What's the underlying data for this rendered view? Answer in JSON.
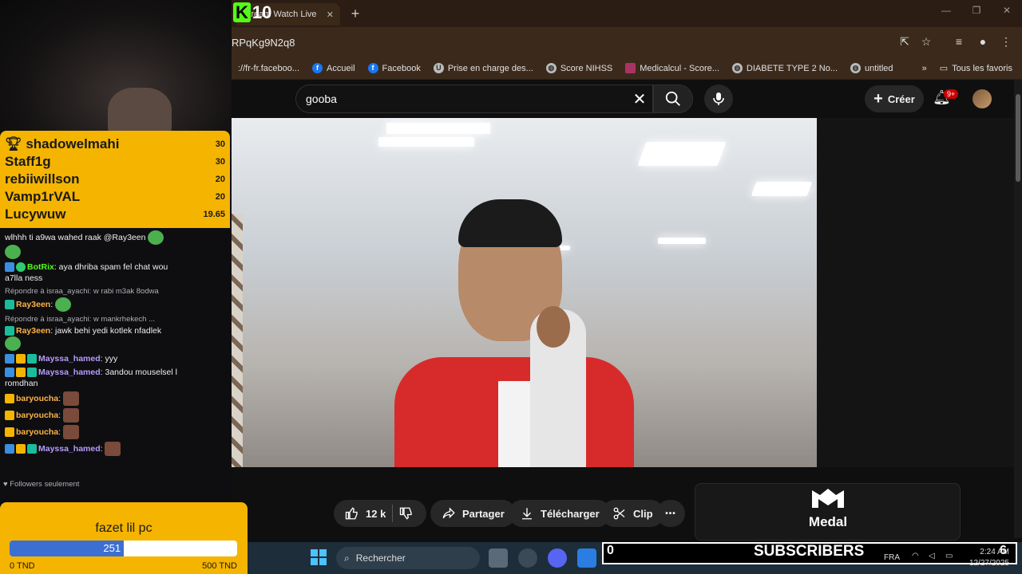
{
  "browser": {
    "tab_title": "Stream Watch Live",
    "url_fragment": "RPqKg9N2q8",
    "bookmarks": [
      "://fr-fr.faceboo...",
      "Accueil",
      "Facebook",
      "Prise en charge des...",
      "Score NIHSS",
      "Medicalcul - Score...",
      "DIABETE TYPE 2 No...",
      "untitled"
    ],
    "bookmarks_more": "»",
    "favorites_label": "Tous les favoris"
  },
  "youtube": {
    "search_value": "gooba",
    "create_label": "Créer",
    "notification_badge": "9+",
    "actions": {
      "likes": "12 k",
      "share": "Partager",
      "download": "Télécharger",
      "clip": "Clip",
      "more": "•••"
    },
    "promo_label": "Medal"
  },
  "stream_overlay": {
    "kick_count": "10",
    "leaderboard": [
      {
        "name": "shadowelmahi",
        "value": "30"
      },
      {
        "name": "Staff1g",
        "value": "30"
      },
      {
        "name": "rebiiwillson",
        "value": "20"
      },
      {
        "name": "Vamp1rVAL",
        "value": "20"
      },
      {
        "name": "Lucywuw",
        "value": "19.65"
      }
    ],
    "chat": {
      "line1": "wlhhh ti a9wa wahed raak @Ray3een",
      "botrix_user": "BotRix",
      "botrix_msg": ": aya dhriba spam fel chat wou a7lla ness",
      "reply1": "Répondre à israa_ayachi: w rabi m3ak 8odwa",
      "ray_user": "Ray3een",
      "reply2": "Répondre à israa_ayachi: w mankrhekech ...",
      "ray_msg": ": jawk behi yedi kotlek nfadlek",
      "mayssa_user": "Mayssa_hamed",
      "mayssa_msg1": ": yyy",
      "mayssa_msg2": ": 3andou mouselsel l romdhan",
      "baryoucha_user": "baryoucha",
      "colon": ":"
    },
    "followers_only": "Followers seulement",
    "goal": {
      "title": "fazet lil pc",
      "current": "251",
      "current_value": 251,
      "min_label": "0 TND",
      "max_label": "500 TND",
      "max_value": 500
    },
    "subscribers_label": "SUBSCRIBERS",
    "subscribers_count": "0",
    "subscribers_goal": "6"
  },
  "taskbar": {
    "search_placeholder": "Rechercher",
    "language": "FRA",
    "time": "2:24 AM",
    "date": "12/27/2025"
  }
}
